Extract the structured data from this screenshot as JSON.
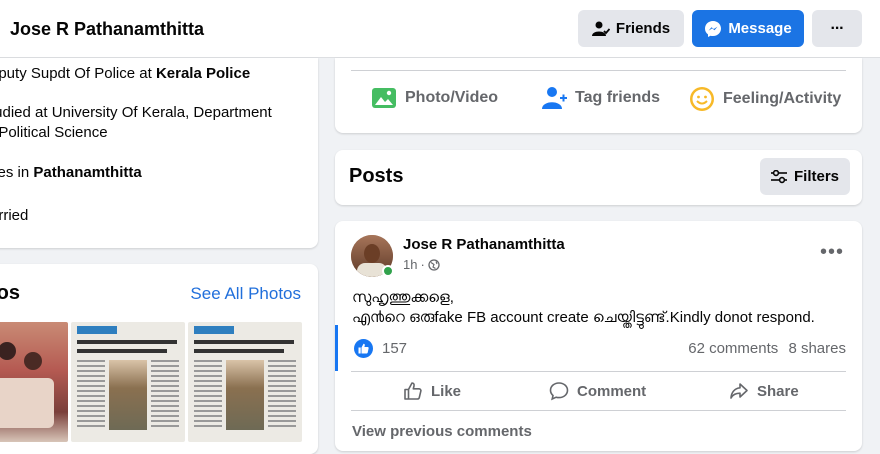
{
  "header": {
    "profile_name": "Jose R Pathanamthitta",
    "friends_label": "Friends",
    "message_label": "Message",
    "more_label": "···"
  },
  "intro": {
    "work_prefix": "eputy Supdt Of Police at ",
    "work_org": "Kerala Police",
    "study_line1": "tudied at University Of Kerala, Department",
    "study_line2": "f Political Science",
    "lives_prefix": "ves in ",
    "lives_place": "Pathanamthitta",
    "relationship": "arried"
  },
  "photos": {
    "title": "tos",
    "see_all": "See All Photos"
  },
  "composer": {
    "photo_video": "Photo/Video",
    "tag_friends": "Tag friends",
    "feeling": "Feeling/Activity"
  },
  "posts_header": {
    "title": "Posts",
    "filters": "Filters"
  },
  "post": {
    "author": "Jose R Pathanamthitta",
    "time": "1h",
    "text_line1": "സുഹൃത്തുക്കളെ,",
    "text_line2": "എ൯റെ ഒരുfake FB account create ചെയ്തിട്ടുണ്ട്.Kindly donot respond.",
    "reactions": "157",
    "comments": "62 comments",
    "shares": "8 shares",
    "like_label": "Like",
    "comment_label": "Comment",
    "share_label": "Share",
    "view_previous": "View previous comments"
  },
  "colors": {
    "accent": "#1b74e4",
    "link": "#216fdb",
    "online": "#31a24c"
  }
}
